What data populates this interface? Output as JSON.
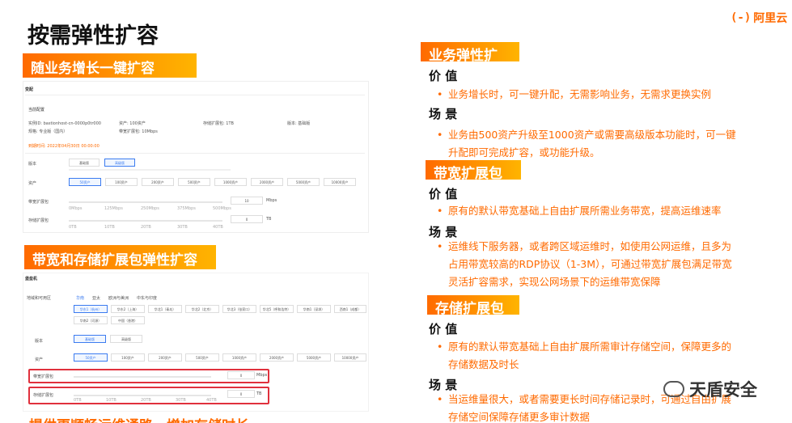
{
  "title": "按需弹性扩容",
  "logo": {
    "mark": "(-)",
    "text": "阿里云"
  },
  "left": {
    "banner1": "随业务增长一键扩容",
    "banner2": "带宽和存储扩展包弹性扩容",
    "panel1": {
      "header": "变配",
      "current_config": "当前配置",
      "instance_id": "实例ID: bastionhost-cn-0000p0tr000",
      "assets": "资产: 100资产",
      "storage": "存储扩展包: 1TB",
      "version": "版本: 基础版",
      "spec": "规格: 专业版（国内）",
      "bandwidth": "带宽扩展包: 10Mbps",
      "expire": "到期时间: 2022年04月30日 00:00:00",
      "version_label": "版本",
      "version_options": [
        "基础版",
        "高级版"
      ],
      "assets_label": "资产",
      "asset_options": [
        "50资产",
        "100资产",
        "200资产",
        "500资产",
        "1000资产",
        "2000资产",
        "5000资产",
        "10000资产"
      ],
      "bandwidth_label": "带宽扩展包",
      "bandwidth_value": "10",
      "bandwidth_unit": "Mbps",
      "bandwidth_ticks": [
        "0Mbps",
        "125Mbps",
        "250Mbps",
        "375Mbps",
        "500Mbps"
      ],
      "storage_label": "存储扩展包",
      "storage_value": "0",
      "storage_unit": "TB",
      "storage_ticks": [
        "0TB",
        "10TB",
        "20TB",
        "30TB",
        "40TB"
      ]
    },
    "panel2": {
      "header": "堡垒机",
      "region_label": "地域和可用区",
      "region_tabs": [
        "华南",
        "亚太",
        "欧洲与美洲",
        "中东与印度"
      ],
      "regions": [
        "华东1（杭州）",
        "华东2（上海）",
        "华北1（青岛）",
        "华北2（北京）",
        "华北3（张家口）",
        "华北5（呼和浩特）",
        "华南1（深圳）",
        "西南1（成都）",
        "华南2（河源）",
        "中国（香港）"
      ],
      "version_label": "版本",
      "version_options": [
        "基础版",
        "高级版"
      ],
      "assets_label": "资产",
      "asset_options": [
        "50资产",
        "100资产",
        "200资产",
        "500资产",
        "1000资产",
        "2000资产",
        "5000资产",
        "10000资产"
      ],
      "bandwidth_label": "带宽扩展包",
      "bandwidth_value": "0",
      "bandwidth_unit": "Mbps",
      "bandwidth_ticks": [
        "0Mbps",
        "125Mbps",
        "250Mbps",
        "375Mbps",
        "500Mbps"
      ],
      "storage_label": "存储扩展包",
      "storage_value": "0",
      "storage_unit": "TB",
      "storage_ticks": [
        "0TB",
        "10TB",
        "20TB",
        "30TB",
        "40TB"
      ]
    },
    "bottom_cut": "提供更顺畅运维通路，增加存储时长"
  },
  "right": {
    "s1": {
      "title": "业务弹性扩",
      "value_label": "价 值",
      "value_text": "业务增长时，可一键升配，无需影响业务，无需求更换实例",
      "scene_label": "场 景",
      "scene_text": "业务由500资产升级至1000资产或需要高级版本功能时，可一键升配即可完成扩容，或功能升级。"
    },
    "s2": {
      "title": "带宽扩展包",
      "value_label": "价 值",
      "value_text": "原有的默认带宽基础上自由扩展所需业务带宽，提高运维速率",
      "scene_label": "场 景",
      "scene_text": "运维线下服务器，或者跨区域运维时，如使用公网运维，且多为占用带宽较高的RDP协议（1-3M），可通过带宽扩展包满足带宽灵活扩容需求，实现公网场景下的运维带宽保障"
    },
    "s3": {
      "title": "存储扩展包",
      "value_label": "价 值",
      "value_text": "原有的默认带宽基础上自由扩展所需审计存储空间，保障更多的存储数据及时长",
      "scene_label": "场 景",
      "scene_text": "当运维量很大，或者需要更长时间存储记录时，可通过自由扩展存储空间保障存储更多审计数据"
    }
  },
  "watermark": "天盾安全"
}
